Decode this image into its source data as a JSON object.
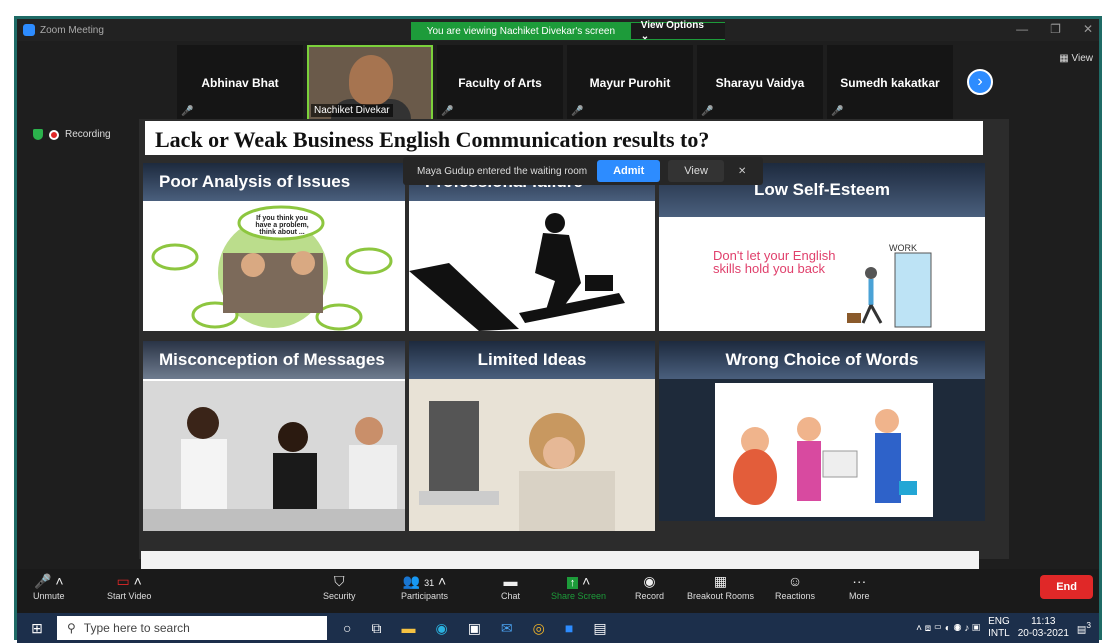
{
  "window": {
    "title": "Zoom Meeting",
    "controls": [
      "—",
      "❐",
      "✕"
    ]
  },
  "banner": {
    "message": "You are viewing Nachiket Divekar's screen",
    "view_options": "View Options ⌄"
  },
  "participants": [
    {
      "name": "Abhinav Bhat"
    },
    {
      "name": "Nachiket Divekar",
      "video": true
    },
    {
      "name": "Faculty of Arts"
    },
    {
      "name": "Mayur Purohit"
    },
    {
      "name": "Sharayu Vaidya"
    },
    {
      "name": "Sumedh kakatkar"
    }
  ],
  "view_label": "View",
  "status": {
    "recording": "Recording"
  },
  "waiting_toast": {
    "message": "Maya Gudup entered the waiting room",
    "admit": "Admit",
    "view": "View",
    "close": "✕"
  },
  "slide": {
    "title": "Lack or Weak Business English Communication results to?",
    "panels": [
      {
        "heading": "Poor Analysis of Issues",
        "bubble": "If you think you have a problem, think about ..."
      },
      {
        "heading": "Professional failure"
      },
      {
        "heading": "Low Self-Esteem",
        "work": "WORK",
        "caption": "Don't let your English skills hold you back"
      },
      {
        "heading": "Misconception of Messages"
      },
      {
        "heading": "Limited Ideas"
      },
      {
        "heading": "Wrong Choice of Words"
      }
    ]
  },
  "toolbar": {
    "unmute": "Unmute",
    "start_video": "Start Video",
    "security": "Security",
    "participants": "Participants",
    "participants_count": "31",
    "chat": "Chat",
    "share_screen": "Share Screen",
    "record": "Record",
    "breakout": "Breakout Rooms",
    "reactions": "Reactions",
    "more": "More",
    "end": "End"
  },
  "taskbar": {
    "search_placeholder": "Type here to search",
    "lang1": "ENG",
    "lang2": "INTL",
    "time": "11:13",
    "date": "20-03-2021",
    "notif": "3"
  }
}
